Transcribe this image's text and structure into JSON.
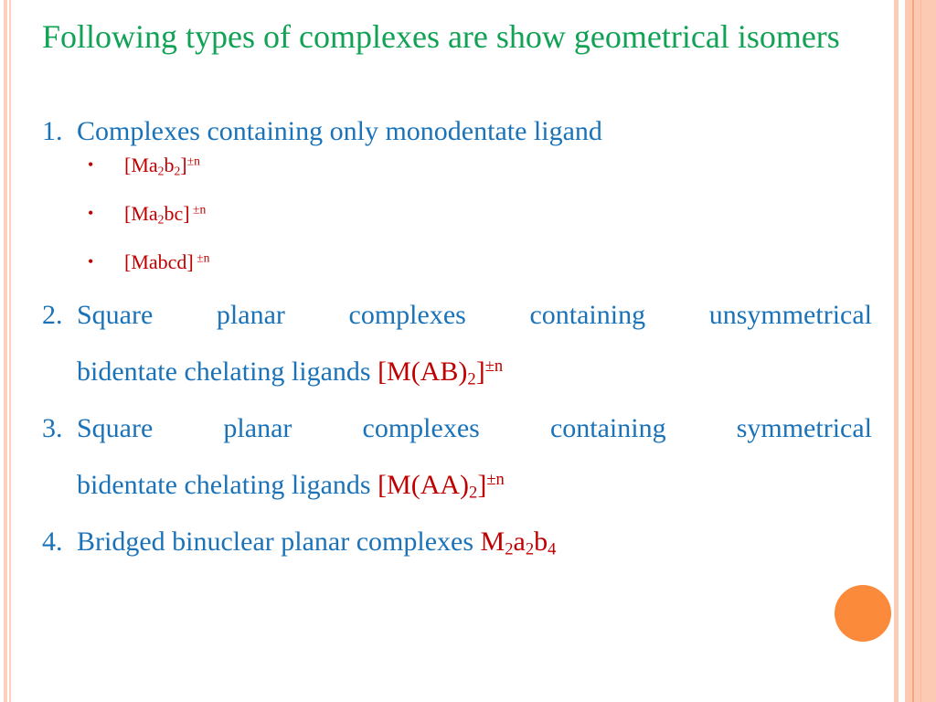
{
  "title": "Following types of complexes are show geometrical isomers",
  "colors": {
    "title": "#12a255",
    "body": "#1a72b8",
    "formula": "#c00000",
    "accent_dot": "#fb8a3a",
    "border": "#fcc9b2"
  },
  "items": [
    {
      "number": "1.",
      "text": "Complexes containing only monodentate ligand",
      "sub_items": [
        {
          "bullet": "•",
          "base": "[Ma",
          "s1": "2",
          "mid": "b",
          "s2": "2",
          "close": "]",
          "charge": "±n"
        },
        {
          "bullet": "•",
          "base": "[Ma",
          "s1": "2",
          "mid": "bc]",
          "charge": " ±n"
        },
        {
          "bullet": "•",
          "base": "[Mabcd]",
          "charge": " ±n"
        }
      ]
    },
    {
      "number": "2.",
      "line1": "Square planar complexes containing unsymmetrical",
      "line2": "bidentate chelating ligands",
      "formula": {
        "base": "[M(AB)",
        "sub": "2",
        "close": "]",
        "charge": "±n"
      }
    },
    {
      "number": "3.",
      "line1": "Square planar complexes containing symmetrical",
      "line2": "bidentate chelating ligands",
      "formula": {
        "base": "[M(AA)",
        "sub": "2",
        "close": "]",
        "charge": "±n"
      }
    },
    {
      "number": "4.",
      "text": "Bridged binuclear planar complexes",
      "formula": {
        "p1": "M",
        "s1": "2",
        "p2": "a",
        "s2": "2",
        "p3": "b",
        "s3": "4"
      }
    }
  ]
}
